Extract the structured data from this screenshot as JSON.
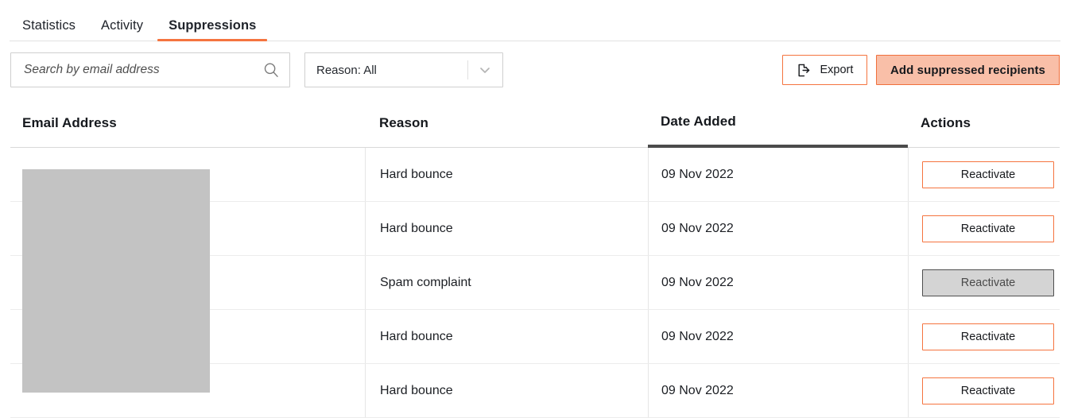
{
  "tabs": [
    {
      "label": "Statistics",
      "active": false
    },
    {
      "label": "Activity",
      "active": false
    },
    {
      "label": "Suppressions",
      "active": true
    }
  ],
  "toolbar": {
    "search": {
      "placeholder": "Search by email address",
      "value": "",
      "icon": "search-icon"
    },
    "reason_filter": {
      "value": "Reason: All",
      "icon": "chevron-down-icon"
    },
    "export_button": {
      "label": "Export",
      "icon": "document-export-icon"
    },
    "add_button": {
      "label": "Add suppressed recipients"
    }
  },
  "table": {
    "columns": [
      {
        "label": "Email Address",
        "sorted": false
      },
      {
        "label": "Reason",
        "sorted": false
      },
      {
        "label": "Date Added",
        "sorted": true
      },
      {
        "label": "Actions",
        "sorted": false
      }
    ],
    "rows": [
      {
        "email": "",
        "reason": "Hard bounce",
        "date": "09 Nov 2022",
        "action": "Reactivate",
        "action_state": "default"
      },
      {
        "email": "",
        "reason": "Hard bounce",
        "date": "09 Nov 2022",
        "action": "Reactivate",
        "action_state": "default"
      },
      {
        "email": "",
        "reason": "Spam complaint",
        "date": "09 Nov 2022",
        "action": "Reactivate",
        "action_state": "disabled"
      },
      {
        "email": "",
        "reason": "Hard bounce",
        "date": "09 Nov 2022",
        "action": "Reactivate",
        "action_state": "default"
      },
      {
        "email": "",
        "reason": "Hard bounce",
        "date": "09 Nov 2022",
        "action": "Reactivate",
        "action_state": "default"
      }
    ]
  },
  "colors": {
    "accent_orange": "#f5743f",
    "accent_fill": "#f9bfa8",
    "accent_border": "#f0703c",
    "sorted_underline": "#4b4b4b",
    "disabled_fill": "#d4d4d4",
    "redaction": "#c3c3c3"
  }
}
